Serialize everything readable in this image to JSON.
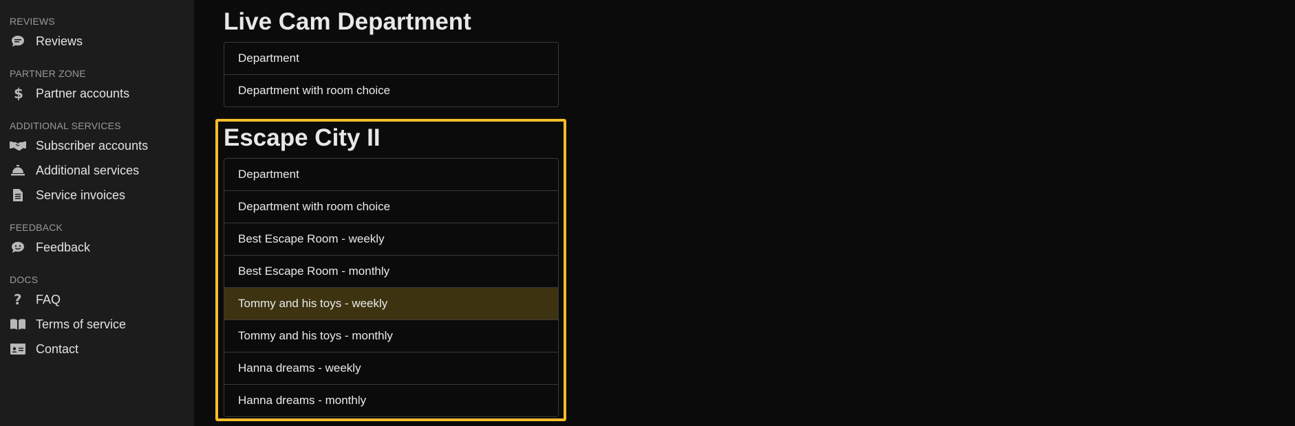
{
  "sidebar": {
    "sections": [
      {
        "title": "REVIEWS",
        "items": [
          {
            "label": "Reviews",
            "icon": "comment-icon"
          }
        ]
      },
      {
        "title": "PARTNER ZONE",
        "items": [
          {
            "label": "Partner accounts",
            "icon": "dollar-icon"
          }
        ]
      },
      {
        "title": "ADDITIONAL SERVICES",
        "items": [
          {
            "label": "Subscriber accounts",
            "icon": "handshake-icon"
          },
          {
            "label": "Additional services",
            "icon": "concierge-bell-icon"
          },
          {
            "label": "Service invoices",
            "icon": "invoice-icon"
          }
        ]
      },
      {
        "title": "FEEDBACK",
        "items": [
          {
            "label": "Feedback",
            "icon": "smile-comment-icon"
          }
        ]
      },
      {
        "title": "DOCS",
        "items": [
          {
            "label": "FAQ",
            "icon": "question-icon"
          },
          {
            "label": "Terms of service",
            "icon": "book-icon"
          },
          {
            "label": "Contact",
            "icon": "id-card-icon"
          }
        ]
      }
    ]
  },
  "main": {
    "departments": [
      {
        "title": "Live Cam Department",
        "items": [
          {
            "label": "Department"
          },
          {
            "label": "Department with room choice"
          }
        ]
      },
      {
        "title": "Escape City II",
        "items": [
          {
            "label": "Department"
          },
          {
            "label": "Department with room choice"
          },
          {
            "label": "Best Escape Room - weekly"
          },
          {
            "label": "Best Escape Room - monthly"
          },
          {
            "label": "Tommy and his toys - weekly",
            "active": true
          },
          {
            "label": "Tommy and his toys - monthly"
          },
          {
            "label": "Hanna dreams - weekly"
          },
          {
            "label": "Hanna dreams - monthly"
          }
        ]
      }
    ]
  },
  "colors": {
    "sidebar_bg": "#1c1c1c",
    "page_bg": "#0b0b0b",
    "highlight_border": "#f4bd2a",
    "active_item_bg": "#3d3311"
  }
}
